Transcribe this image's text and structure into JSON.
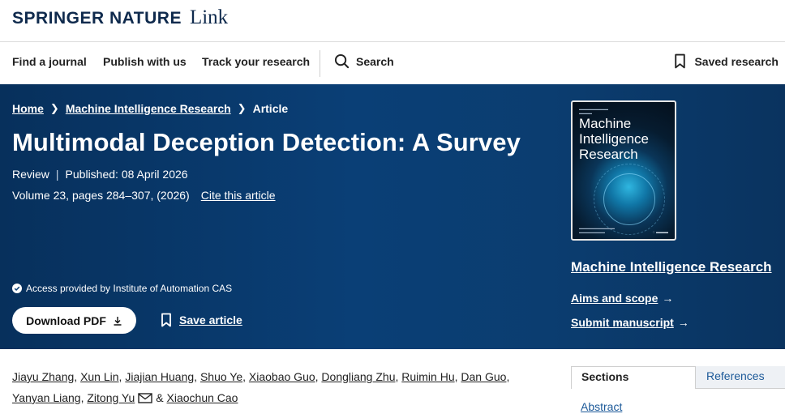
{
  "brand": {
    "name": "SPRINGER NATURE",
    "sub": "Link"
  },
  "nav": {
    "items": [
      "Find a journal",
      "Publish with us",
      "Track your research"
    ],
    "search_label": "Search",
    "saved_label": "Saved research"
  },
  "breadcrumb": [
    "Home",
    "Machine Intelligence Research",
    "Article"
  ],
  "article": {
    "title": "Multimodal Deception Detection: A Survey",
    "type": "Review",
    "published": "Published: 08 April 2026",
    "volume": "Volume 23, pages 284–307, (2026)",
    "cite_label": "Cite this article",
    "access": "Access provided by Institute of Automation CAS",
    "download_label": "Download PDF",
    "save_label": "Save article"
  },
  "cover": {
    "title_line1": "Machine",
    "title_line2": "Intelligence",
    "title_line3": "Research"
  },
  "journal": {
    "name": "Machine Intelligence Research",
    "aims_label": "Aims and scope",
    "submit_label": "Submit manuscript"
  },
  "authors": [
    "Jiayu Zhang",
    "Xun Lin",
    "Jiajian Huang",
    "Shuo Ye",
    "Xiaobao Guo",
    "Dongliang Zhu",
    "Ruimin Hu",
    "Dan Guo",
    "Yanyan Liang",
    "Zitong Yu",
    "Xiaochun Cao"
  ],
  "tabs": {
    "sections": "Sections",
    "references": "References"
  },
  "sections": {
    "abstract": "Abstract"
  },
  "colors": {
    "hero_bg": "#0a3f76",
    "link": "#1d5a99",
    "brand": "#0f2a4d"
  }
}
